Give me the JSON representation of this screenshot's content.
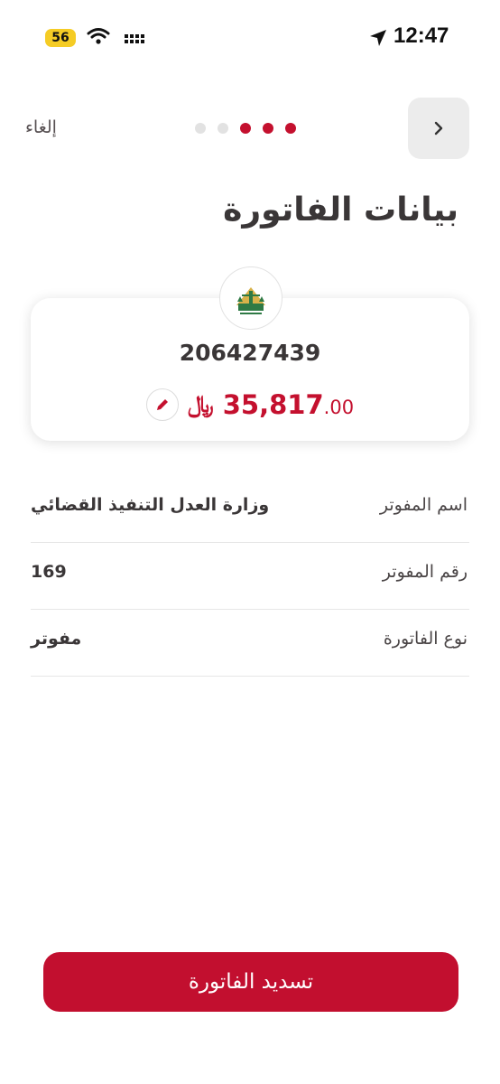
{
  "status_bar": {
    "time": "12:47",
    "battery": "56"
  },
  "header": {
    "cancel_label": "إلغاء",
    "steps_total": 5,
    "steps_done": 3
  },
  "title": "بيانات الفاتورة",
  "invoice": {
    "number": "206427439",
    "currency_symbol": "﷼",
    "amount_int": "35,817",
    "amount_dec": ".00"
  },
  "details": [
    {
      "label": "اسم المفوتر",
      "value": "وزارة العدل التنفيذ القضائي"
    },
    {
      "label": "رقم المفوتر",
      "value": "169"
    },
    {
      "label": "نوع الفاتورة",
      "value": "مفوتر"
    }
  ],
  "pay_button": "تسديد الفاتورة",
  "colors": {
    "accent": "#c4102e",
    "text": "#3a3637"
  }
}
